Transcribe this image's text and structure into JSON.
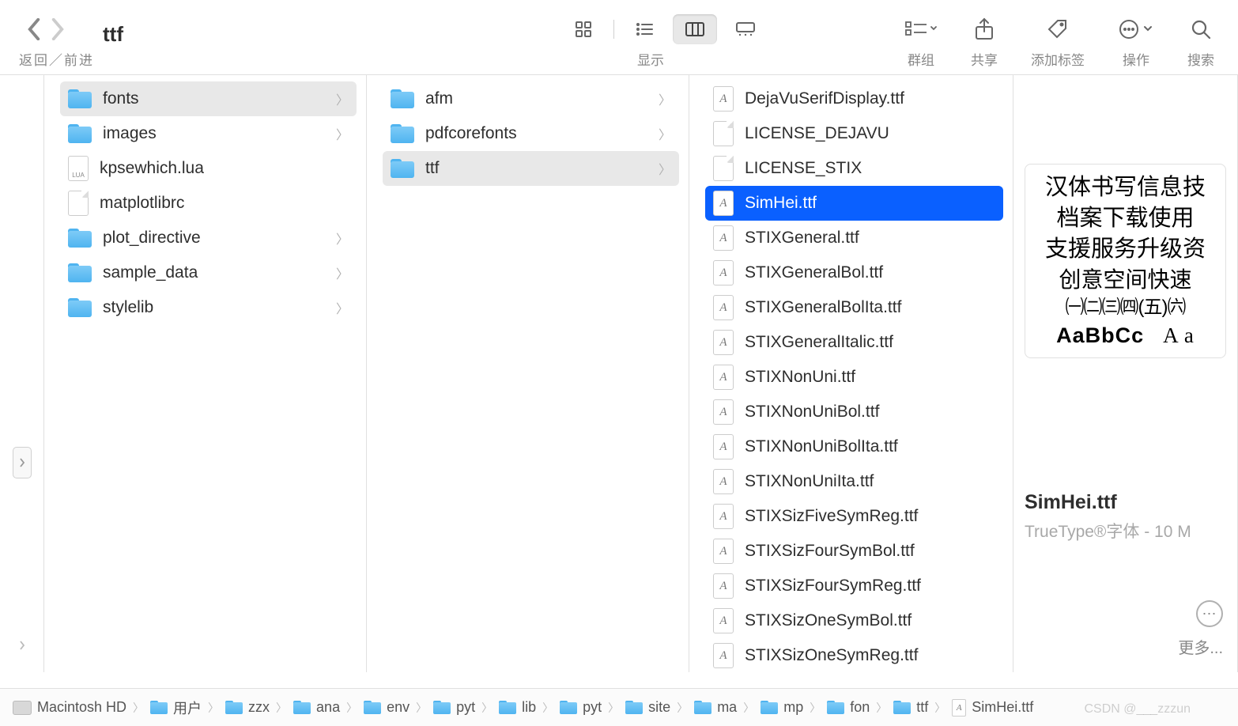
{
  "toolbar": {
    "nav_label": "返回／前进",
    "title": "ttf",
    "view_label": "显示",
    "groups_label": "群组",
    "share_label": "共享",
    "tags_label": "添加标签",
    "actions_label": "操作",
    "search_label": "搜索"
  },
  "col1": [
    {
      "name": "fonts",
      "kind": "folder",
      "children": true,
      "selected": true
    },
    {
      "name": "images",
      "kind": "folder",
      "children": true
    },
    {
      "name": "kpsewhich.lua",
      "kind": "lua"
    },
    {
      "name": "matplotlibrc",
      "kind": "file"
    },
    {
      "name": "plot_directive",
      "kind": "folder",
      "children": true
    },
    {
      "name": "sample_data",
      "kind": "folder",
      "children": true
    },
    {
      "name": "stylelib",
      "kind": "folder",
      "children": true
    }
  ],
  "col2": [
    {
      "name": "afm",
      "kind": "folder",
      "children": true
    },
    {
      "name": "pdfcorefonts",
      "kind": "folder",
      "children": true
    },
    {
      "name": "ttf",
      "kind": "folder",
      "children": true,
      "selected": true
    }
  ],
  "col3": [
    {
      "name": "DejaVuSerifDisplay.ttf",
      "kind": "font"
    },
    {
      "name": "LICENSE_DEJAVU",
      "kind": "file"
    },
    {
      "name": "LICENSE_STIX",
      "kind": "file"
    },
    {
      "name": "SimHei.ttf",
      "kind": "font",
      "selected": true
    },
    {
      "name": "STIXGeneral.ttf",
      "kind": "font"
    },
    {
      "name": "STIXGeneralBol.ttf",
      "kind": "font"
    },
    {
      "name": "STIXGeneralBolIta.ttf",
      "kind": "font"
    },
    {
      "name": "STIXGeneralItalic.ttf",
      "kind": "font"
    },
    {
      "name": "STIXNonUni.ttf",
      "kind": "font"
    },
    {
      "name": "STIXNonUniBol.ttf",
      "kind": "font"
    },
    {
      "name": "STIXNonUniBolIta.ttf",
      "kind": "font"
    },
    {
      "name": "STIXNonUniIta.ttf",
      "kind": "font"
    },
    {
      "name": "STIXSizFiveSymReg.ttf",
      "kind": "font"
    },
    {
      "name": "STIXSizFourSymBol.ttf",
      "kind": "font"
    },
    {
      "name": "STIXSizFourSymReg.ttf",
      "kind": "font"
    },
    {
      "name": "STIXSizOneSymBol.ttf",
      "kind": "font"
    },
    {
      "name": "STIXSizOneSymReg.ttf",
      "kind": "font"
    }
  ],
  "preview": {
    "lines": [
      "汉体书写信息技",
      "档案下载使用",
      "支援服务升级资",
      "创意空间快速",
      "㈠㈡㈢㈣(五)㈥"
    ],
    "sample_bold": "AaBbCc",
    "sample_serif": "A a",
    "name": "SimHei.ttf",
    "meta": "TrueType®字体 - 10 M"
  },
  "more_label": "更多...",
  "path": [
    {
      "name": "Macintosh HD",
      "kind": "disk"
    },
    {
      "name": "用户",
      "kind": "folder"
    },
    {
      "name": "zzx",
      "kind": "folder"
    },
    {
      "name": "ana",
      "kind": "folder"
    },
    {
      "name": "env",
      "kind": "folder"
    },
    {
      "name": "pyt",
      "kind": "folder"
    },
    {
      "name": "lib",
      "kind": "folder"
    },
    {
      "name": "pyt",
      "kind": "folder"
    },
    {
      "name": "site",
      "kind": "folder"
    },
    {
      "name": "ma",
      "kind": "folder"
    },
    {
      "name": "mp",
      "kind": "folder"
    },
    {
      "name": "fon",
      "kind": "folder"
    },
    {
      "name": "ttf",
      "kind": "folder"
    },
    {
      "name": "SimHei.ttf",
      "kind": "font"
    }
  ],
  "watermark": "CSDN @___zzzun"
}
